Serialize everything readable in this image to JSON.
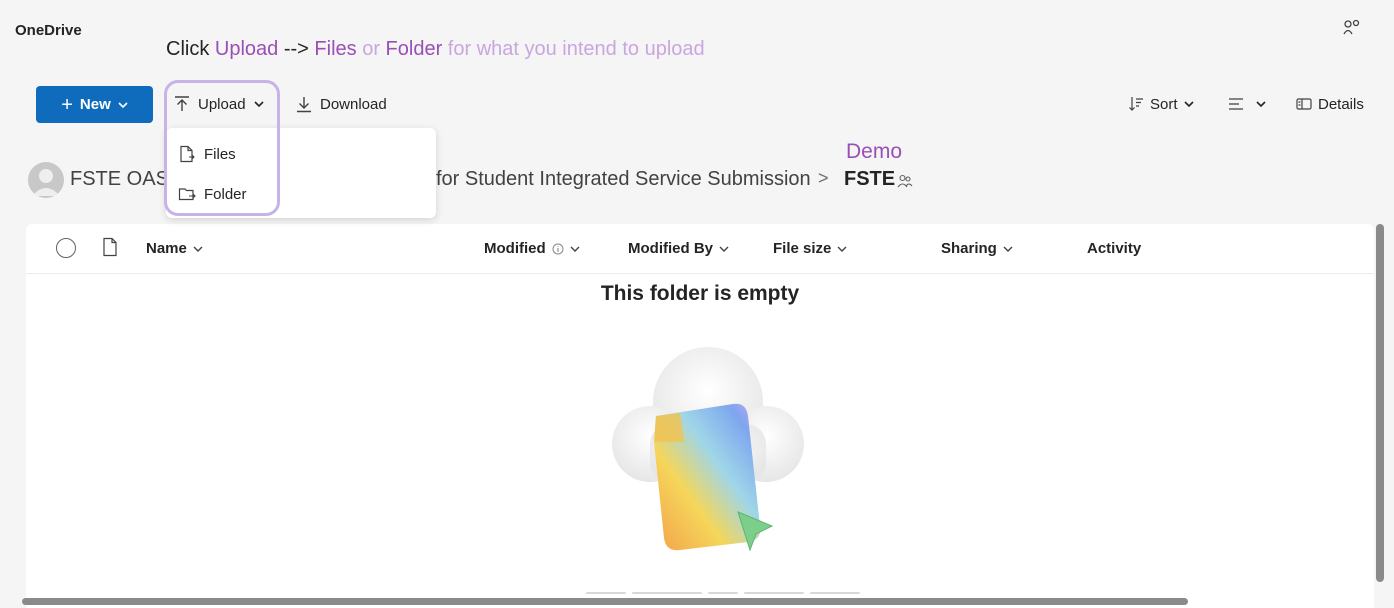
{
  "app": {
    "title": "OneDrive"
  },
  "instruction": {
    "w1": "Click ",
    "w2": "Upload",
    "w3": " --> ",
    "w4": "Files",
    "w5": " or ",
    "w6": "Folder",
    "w7": " for what you intend to upload"
  },
  "toolbar": {
    "new_label": "New",
    "upload_label": "Upload",
    "download_label": "Download",
    "sort_label": "Sort",
    "details_label": "Details"
  },
  "upload_menu": {
    "items": [
      {
        "label": "Files",
        "icon": "file-upload-icon"
      },
      {
        "label": "Folder",
        "icon": "folder-upload-icon"
      }
    ]
  },
  "breadcrumb": {
    "root": "FSTE OASI",
    "middle": "for Student Integrated Service Submission",
    "separator": ">",
    "current": "FSTE",
    "annotation": "Demo"
  },
  "columns": {
    "name": "Name",
    "modified": "Modified",
    "modified_by": "Modified By",
    "file_size": "File size",
    "sharing": "Sharing",
    "activity": "Activity"
  },
  "empty_state": {
    "title": "This folder is empty"
  },
  "colors": {
    "accent": "#0f6cbd",
    "annotation": "#9a4fb5",
    "highlight_border": "#c7b3e8"
  }
}
